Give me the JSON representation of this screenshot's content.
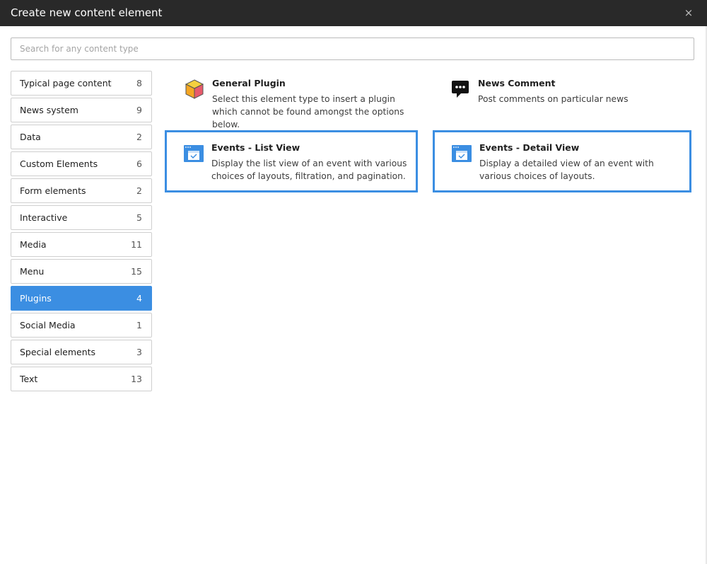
{
  "dialog": {
    "title": "Create new content element",
    "close_label": "×"
  },
  "search": {
    "placeholder": "Search for any content type",
    "value": ""
  },
  "categories": [
    {
      "label": "Typical page content",
      "count": "8"
    },
    {
      "label": "News system",
      "count": "9"
    },
    {
      "label": "Data",
      "count": "2"
    },
    {
      "label": "Custom Elements",
      "count": "6"
    },
    {
      "label": "Form elements",
      "count": "2"
    },
    {
      "label": "Interactive",
      "count": "5"
    },
    {
      "label": "Media",
      "count": "11"
    },
    {
      "label": "Menu",
      "count": "15"
    },
    {
      "label": "Plugins",
      "count": "4"
    },
    {
      "label": "Social Media",
      "count": "1"
    },
    {
      "label": "Special elements",
      "count": "3"
    },
    {
      "label": "Text",
      "count": "13"
    }
  ],
  "active_category": "Plugins",
  "elements": [
    {
      "title": "General Plugin",
      "description": "Select this element type to insert a plugin which cannot be found amongst the options below.",
      "icon": "plugin-cube-icon"
    },
    {
      "title": "News Comment",
      "description": "Post comments on particular news",
      "icon": "comment-bubble-icon"
    },
    {
      "title": "Events - List View",
      "description": "Display the list view of an event with various choices of layouts, filtration, and pagination.",
      "icon": "calendar-window-icon"
    },
    {
      "title": "Events - Detail View",
      "description": "Display a detailed view of an event with various choices of layouts.",
      "icon": "calendar-window-icon"
    }
  ],
  "colors": {
    "header_bg": "#292929",
    "accent": "#3b8ee2",
    "border": "#cfcfcf"
  }
}
